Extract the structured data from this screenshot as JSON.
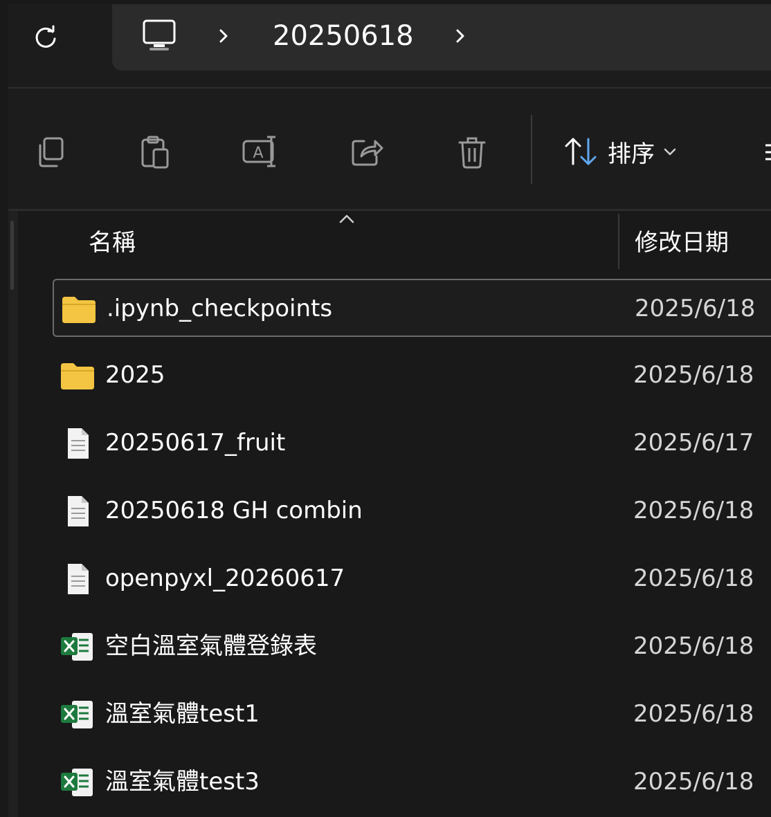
{
  "address_bar": {
    "refresh_icon": "refresh-icon",
    "location_icon": "computer-icon",
    "crumbs": [
      "20250618"
    ]
  },
  "toolbar": {
    "icons": [
      "copy-icon",
      "paste-icon",
      "rename-icon",
      "share-icon",
      "delete-icon"
    ],
    "sort_label": "排序"
  },
  "columns": {
    "name": "名稱",
    "modified": "修改日期"
  },
  "files": [
    {
      "name": ".ipynb_checkpoints",
      "type": "folder",
      "modified": "2025/6/18",
      "selected": true
    },
    {
      "name": "2025",
      "type": "folder",
      "modified": "2025/6/18",
      "selected": false
    },
    {
      "name": "20250617_fruit",
      "type": "document",
      "modified": "2025/6/17",
      "selected": false
    },
    {
      "name": "20250618 GH combin",
      "type": "document",
      "modified": "2025/6/18",
      "selected": false
    },
    {
      "name": "openpyxl_20260617",
      "type": "document",
      "modified": "2025/6/18",
      "selected": false
    },
    {
      "name": "空白溫室氣體登錄表",
      "type": "excel",
      "modified": "2025/6/18",
      "selected": false
    },
    {
      "name": "溫室氣體test1",
      "type": "excel",
      "modified": "2025/6/18",
      "selected": false
    },
    {
      "name": "溫室氣體test3",
      "type": "excel",
      "modified": "2025/6/18",
      "selected": false
    }
  ],
  "colors": {
    "background": "#191919",
    "folder": "#f4c542",
    "excel": "#1d7a3e",
    "accent_sort_arrow": "#60a8f0"
  }
}
